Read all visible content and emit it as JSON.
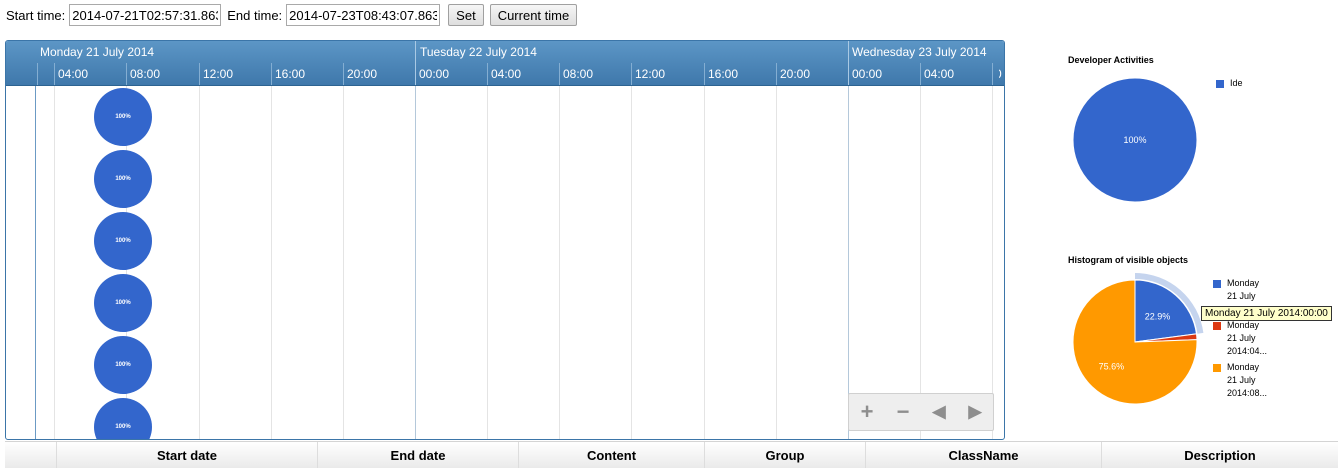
{
  "controls": {
    "start_label": "Start time:",
    "start_value": "2014-07-21T02:57:31.863",
    "end_label": "End time:",
    "end_value": "2014-07-23T08:43:07.863",
    "set_label": "Set",
    "current_time_label": "Current time"
  },
  "timeline": {
    "major_labels": [
      "Monday 21 July 2014",
      "Tuesday 22 July 2014",
      "Wednesday 23 July 2014"
    ],
    "minor_labels": [
      "04:00",
      "08:00",
      "12:00",
      "16:00",
      "20:00",
      "00:00",
      "04:00",
      "08:00",
      "12:00",
      "16:00",
      "20:00",
      "00:00",
      "04:00",
      "0"
    ],
    "events": [
      {
        "label": "100%",
        "color": "#3366cc"
      },
      {
        "label": "100%",
        "color": "#3366cc"
      },
      {
        "label": "100%",
        "color": "#3366cc"
      },
      {
        "label": "100%",
        "color": "#3366cc"
      },
      {
        "label": "100%",
        "color": "#3366cc"
      },
      {
        "label": "100%",
        "color": "#3366cc"
      }
    ],
    "nav": {
      "zoom_in": "+",
      "zoom_out": "−",
      "move_left": "◀",
      "move_right": "▶"
    }
  },
  "developer_chart": {
    "title": "Developer Activities",
    "legend": [
      {
        "label": "Ide",
        "color": "#3366cc"
      }
    ],
    "slice_label": "100%"
  },
  "histogram_chart": {
    "title": "Histogram of visible objects",
    "legend": [
      {
        "lines": [
          "Monday",
          "21 July"
        ],
        "color": "#3366cc"
      },
      {
        "lines": [
          "Monday",
          "21 July",
          "2014:04..."
        ],
        "color": "#dc3912"
      },
      {
        "lines": [
          "Monday",
          "21 July",
          "2014:08..."
        ],
        "color": "#ff9900"
      }
    ],
    "slice_labels": [
      "22.9%",
      "75.6%"
    ],
    "tooltip": "Monday 21 July 2014:00:00"
  },
  "chart_data": [
    {
      "type": "pie",
      "title": "Developer Activities",
      "categories": [
        "Ide"
      ],
      "values": [
        100
      ],
      "colors": [
        "#3366cc"
      ],
      "legend": "right"
    },
    {
      "type": "pie",
      "title": "Histogram of visible objects",
      "categories": [
        "Monday 21 July 2014:00:00",
        "Monday 21 July 2014:04...",
        "Monday 21 July 2014:08..."
      ],
      "values": [
        22.9,
        1.5,
        75.6
      ],
      "colors": [
        "#3366cc",
        "#dc3912",
        "#ff9900"
      ],
      "legend": "right"
    }
  ],
  "table": {
    "headers": [
      "",
      "Start date",
      "End date",
      "Content",
      "Group",
      "ClassName",
      "Description"
    ]
  }
}
